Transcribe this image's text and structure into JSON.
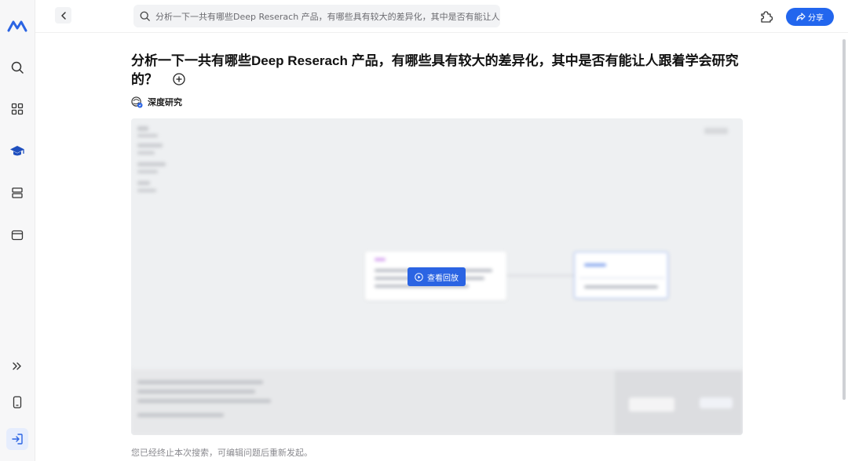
{
  "topbar": {
    "search_text": "分析一下一共有哪些Deep Reserach 产品，有哪些具有较大的差异化，其中是否有能让人跟着学会研究的？",
    "share_label": "分享"
  },
  "main": {
    "question": "分析一下一共有哪些Deep Reserach 产品，有哪些具有较大的差异化，其中是否有能让人跟着学会研究的？",
    "mode_label": "深度研究",
    "replay_button_label": "查看回放",
    "footer_note": "您已经终止本次搜索，可编辑问题后重新发起。"
  },
  "rail": {
    "items": [
      "logo-icon",
      "search-icon",
      "apps-icon",
      "academic-cap-icon",
      "stack-icon",
      "window-icon",
      "expand-icon",
      "phone-icon",
      "login-icon"
    ]
  },
  "colors": {
    "accent": "#2266ee",
    "rail_background": "#f7f7f8"
  }
}
